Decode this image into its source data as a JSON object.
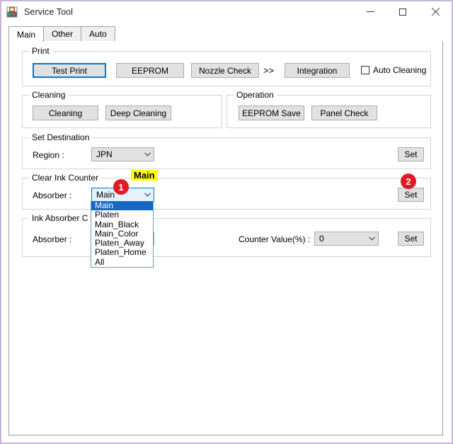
{
  "window": {
    "title": "Service Tool",
    "icon": "app-icon",
    "border_color": "#c8b4dc",
    "controls": {
      "minimize": "minimize",
      "maximize": "maximize",
      "close": "close"
    }
  },
  "tabs": [
    {
      "label": "Main",
      "active": true
    },
    {
      "label": "Other",
      "active": false
    },
    {
      "label": "Auto",
      "active": false
    }
  ],
  "groups": {
    "print": {
      "title": "Print",
      "buttons": [
        {
          "label": "Test Print",
          "focused": true
        },
        {
          "label": "EEPROM",
          "focused": false
        },
        {
          "label": "Nozzle Check",
          "focused": false
        },
        {
          "label": "Integration",
          "focused": false
        }
      ],
      "separator": ">>",
      "checkbox": {
        "label": "Auto Cleaning",
        "checked": false
      }
    },
    "cleaning": {
      "title": "Cleaning",
      "buttons": [
        {
          "label": "Cleaning"
        },
        {
          "label": "Deep Cleaning"
        }
      ]
    },
    "operation": {
      "title": "Operation",
      "buttons": [
        {
          "label": "EEPROM Save"
        },
        {
          "label": "Panel Check"
        }
      ]
    },
    "set_destination": {
      "title": "Set Destination",
      "region_label": "Region :",
      "region_value": "JPN",
      "set_label": "Set"
    },
    "clear_ink_counter": {
      "title": "Clear Ink Counter",
      "absorber_label": "Absorber :",
      "absorber_value": "Main",
      "set_label": "Set",
      "dropdown_open": true,
      "options": [
        {
          "label": "Main",
          "selected": true
        },
        {
          "label": "Platen",
          "selected": false
        },
        {
          "label": "Main_Black",
          "selected": false
        },
        {
          "label": "Main_Color",
          "selected": false
        },
        {
          "label": "Platen_Away",
          "selected": false
        },
        {
          "label": "Platen_Home",
          "selected": false
        },
        {
          "label": "All",
          "selected": false
        }
      ]
    },
    "ink_absorber_counter": {
      "title": "Ink Absorber C",
      "absorber_label": "Absorber :",
      "counter_label": "Counter Value(%) :",
      "counter_value": "0",
      "set_label": "Set"
    }
  },
  "annotations": {
    "badge1": "1",
    "badge2": "2",
    "note_main": "Main",
    "badge_color": "#e01b24",
    "highlight_color": "#ffff00"
  }
}
